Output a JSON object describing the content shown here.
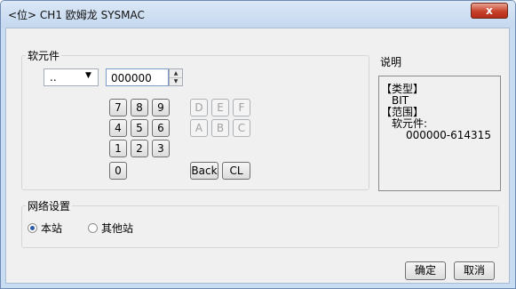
{
  "window": {
    "title": "<位> CH1 欧姆龙 SYSMAC",
    "close_glyph": "x"
  },
  "device_group": {
    "legend": "软元件",
    "device_type": {
      "selected": "..",
      "arrow": "▼"
    },
    "address": {
      "value": "000000",
      "spin_up": "▲",
      "spin_down": "▼"
    },
    "keypad": {
      "digits": [
        "7",
        "8",
        "9",
        "4",
        "5",
        "6",
        "1",
        "2",
        "3",
        "0"
      ],
      "hex": [
        "D",
        "E",
        "F",
        "A",
        "B",
        "C"
      ],
      "back_label": "Back",
      "clear_label": "CL"
    }
  },
  "description": {
    "title": "说明",
    "type_header": "【类型】",
    "type_value": "BIT",
    "range_header": "【范围】",
    "range_label": "软元件:",
    "range_value": "000000-614315"
  },
  "network_group": {
    "legend": "网络设置",
    "options": [
      {
        "label": "本站",
        "selected": true
      },
      {
        "label": "其他站",
        "selected": false
      }
    ]
  },
  "buttons": {
    "ok_label": "确定",
    "cancel_label": "取消"
  },
  "colors": {
    "titlebar": "#c4d8ef",
    "close_button": "#c7422a",
    "dialog_bg": "#f0f0f0",
    "radio_selected": "#2d58a8"
  }
}
